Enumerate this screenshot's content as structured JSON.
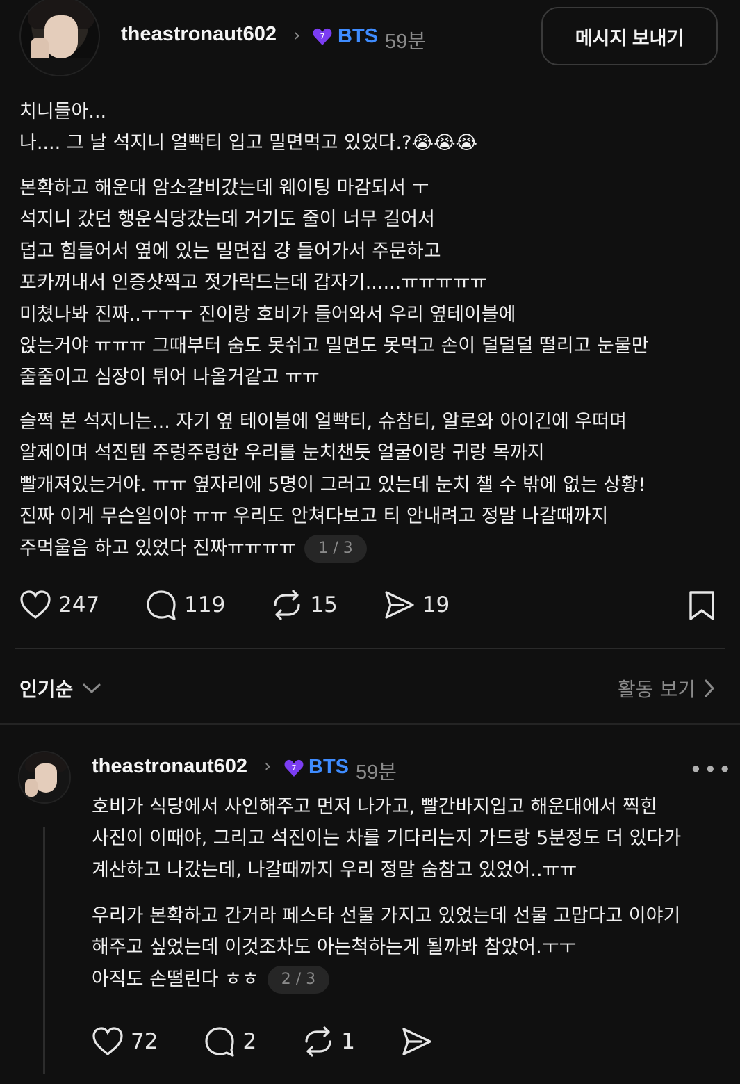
{
  "post": {
    "username": "theastronaut602",
    "tag": "BTS",
    "time": "59분",
    "message_button": "메시지 보내기",
    "para1": "치니들아...\n나.... 그 날 석지니 얼빡티 입고 밀면먹고 있었다.?😭😭😭",
    "para2": "본확하고 해운대 암소갈비갔는데 웨이팅 마감되서 ㅜ\n석지니 갔던 행운식당갔는데 거기도 줄이 너무 길어서\n덥고 힘들어서 옆에 있는 밀면집 걍 들어가서 주문하고\n포카꺼내서 인증샷찍고 젓가락드는데 갑자기......ㅠㅠㅠㅠㅠ\n미쳤나봐 진짜..ㅜㅜㅜ 진이랑 호비가 들어와서 우리 옆테이블에\n앉는거야 ㅠㅠㅠ 그때부터 숨도 못쉬고 밀면도 못먹고 손이 덜덜덜 떨리고 눈물만\n줄줄이고 심장이 튀어 나올거같고 ㅠㅠ",
    "para3": "슬쩍 본 석지니는... 자기 옆 테이블에 얼빡티, 슈참티, 알로와 아이긴에 우떠며\n알제이며 석진템 주렁주렁한 우리를 눈치챈듯 얼굴이랑 귀랑 목까지\n빨개져있는거야. ㅠㅠ 옆자리에 5명이 그러고 있는데 눈치 챌 수 밖에 없는 상황!\n진짜 이게 무슨일이야 ㅠㅠ 우리도 안쳐다보고 티 안내려고 정말 나갈때까지\n주먹울음 하고 있었다 진짜ㅠㅠㅠㅠ",
    "pager": "1 / 3",
    "likes": "247",
    "comments": "119",
    "reposts": "15",
    "shares": "19"
  },
  "sort": {
    "label": "인기순",
    "activity": "활동 보기"
  },
  "reply": {
    "username": "theastronaut602",
    "tag": "BTS",
    "time": "59분",
    "para1": "호비가 식당에서 사인해주고 먼저 나가고, 빨간바지입고 해운대에서 찍힌\n사진이 이때야, 그리고 석진이는 차를 기다리는지 가드랑 5분정도 더 있다가\n계산하고 나갔는데, 나갈때까지 우리 정말 숨참고 있었어..ㅠㅠ",
    "para2": "우리가 본확하고 간거라 페스타 선물 가지고 있었는데 선물 고맙다고 이야기\n해주고 싶었는데 이것조차도 아는척하는게 될까봐 참았어.ㅜㅜ\n아직도 손떨린다 ㅎㅎ",
    "pager": "2 / 3",
    "likes": "72",
    "comments": "2",
    "reposts": "1"
  },
  "colors": {
    "background": "#101010",
    "accent_tag": "#3f8cff",
    "muted": "#8a8a8a",
    "badge_purple": "#7b3df2"
  },
  "icons": [
    "chevron-right-icon",
    "purple-heart-badge-icon",
    "heart-icon",
    "comment-icon",
    "repost-icon",
    "share-icon",
    "bookmark-icon",
    "chevron-down-icon",
    "more-icon"
  ]
}
